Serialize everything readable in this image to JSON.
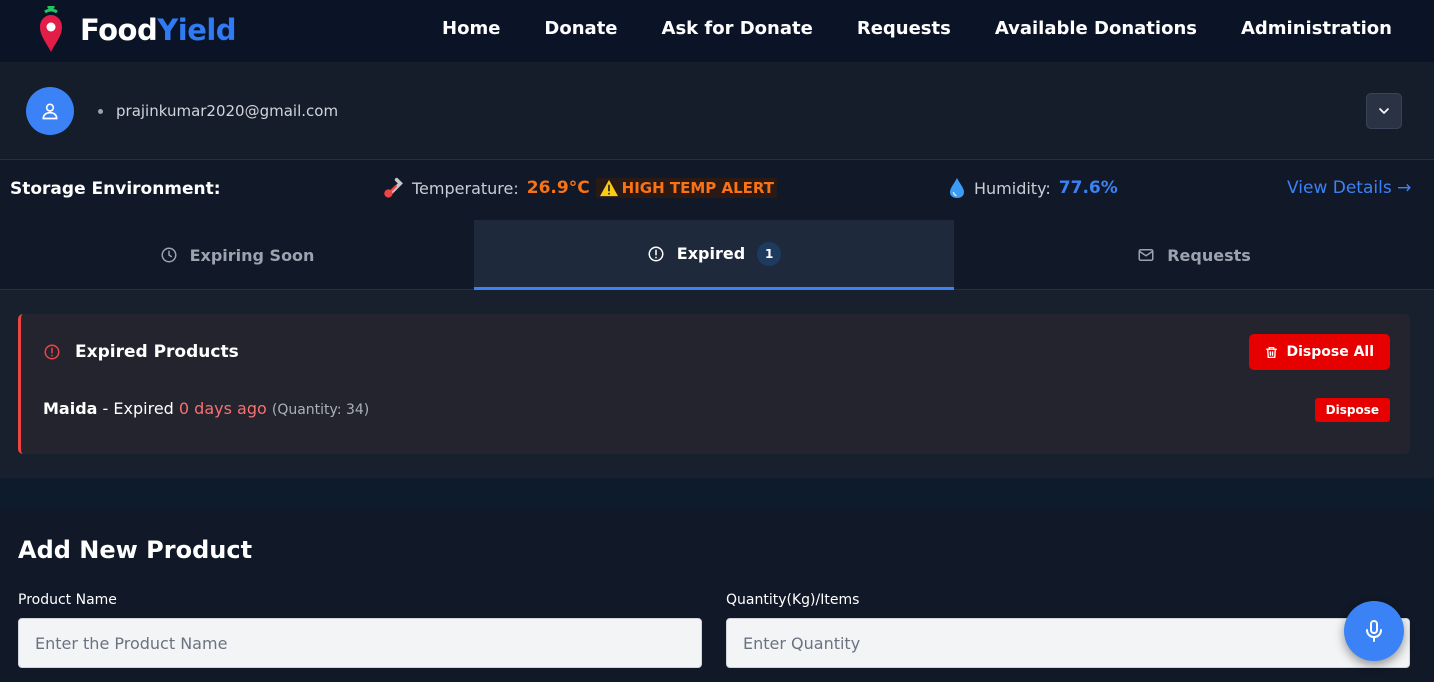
{
  "brand": {
    "name_part1": "Food",
    "name_part2": "Yield"
  },
  "nav": [
    "Home",
    "Donate",
    "Ask for Donate",
    "Requests",
    "Available Donations",
    "Administration"
  ],
  "user": {
    "email": "prajinkumar2020@gmail.com"
  },
  "environment": {
    "title": "Storage Environment:",
    "temperature_label": "Temperature:",
    "temperature_value": "26.9°C",
    "alert_text": "HIGH TEMP ALERT",
    "humidity_label": "Humidity:",
    "humidity_value": "77.6%",
    "view_details": "View Details →"
  },
  "tabs": [
    {
      "label": "Expiring Soon",
      "active": false
    },
    {
      "label": "Expired",
      "active": true,
      "badge": "1"
    },
    {
      "label": "Requests",
      "active": false
    }
  ],
  "expired": {
    "title": "Expired Products",
    "dispose_all_label": "Dispose All",
    "items": [
      {
        "name": "Maida",
        "status": "- Expired",
        "ago": "0 days ago",
        "quantity": "(Quantity: 34)",
        "dispose_label": "Dispose"
      }
    ]
  },
  "add_product": {
    "title": "Add New Product",
    "product_name_label": "Product Name",
    "product_name_placeholder": "Enter the Product Name",
    "quantity_label": "Quantity(Kg)/Items",
    "quantity_placeholder": "Enter Quantity"
  },
  "colors": {
    "accent": "#3b82f6",
    "danger": "#e60000",
    "warning": "#f97316"
  }
}
